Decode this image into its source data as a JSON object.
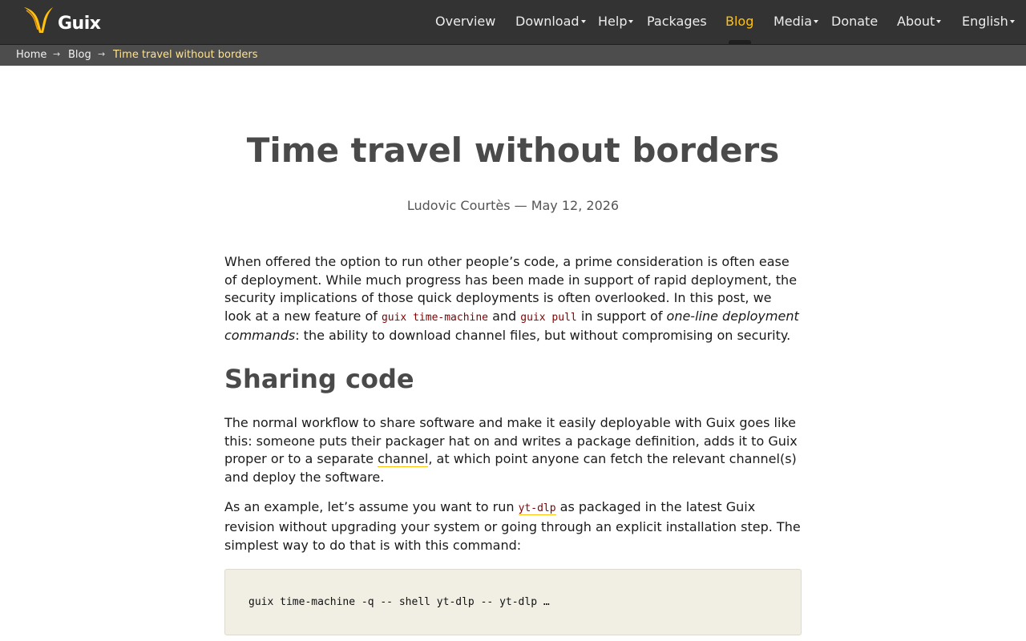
{
  "site": {
    "logo_text": "Guix",
    "accent_color": "#ffc10e"
  },
  "nav": {
    "overview": "Overview",
    "download": "Download",
    "help": "Help",
    "packages": "Packages",
    "blog": "Blog",
    "media": "Media",
    "donate": "Donate",
    "about": "About",
    "language": "English",
    "active": "Blog"
  },
  "breadcrumb": {
    "home": "Home",
    "blog": "Blog",
    "current": "Time travel without borders",
    "separator": "→"
  },
  "article": {
    "title": "Time travel without borders",
    "byline": "Ludovic Courtès — May 12, 2026",
    "p1": {
      "t1": "When offered the option to run other people’s code, a prime consideration is often ease of deployment. While much progress has been made in support of rapid deployment, the security implications of those quick deployments is often overlooked. In this post, we look at a new feature of ",
      "code1": "guix time-machine",
      "t2": " and ",
      "code2": "guix pull",
      "t3": " in support of ",
      "em": "one-line deployment commands",
      "t4": ": the ability to download channel files, but without compromising on security."
    },
    "h2": "Sharing code",
    "p2": {
      "t1": "The normal workflow to share software and make it easily deployable with Guix goes like this: someone puts their packager hat on and writes a package definition, adds it to Guix proper or to a separate ",
      "link": "channel",
      "t2": ", at which point anyone can fetch the relevant channel(s) and deploy the software."
    },
    "p3": {
      "t1": "As an example, let’s assume you want to run ",
      "code_link": "yt-dlp",
      "t2": " as packaged in the latest Guix revision without upgrading your system or going through an explicit installation step. The simplest way to do that is with this command:"
    },
    "command": "guix time-machine -q -- shell yt-dlp -- yt-dlp …"
  }
}
